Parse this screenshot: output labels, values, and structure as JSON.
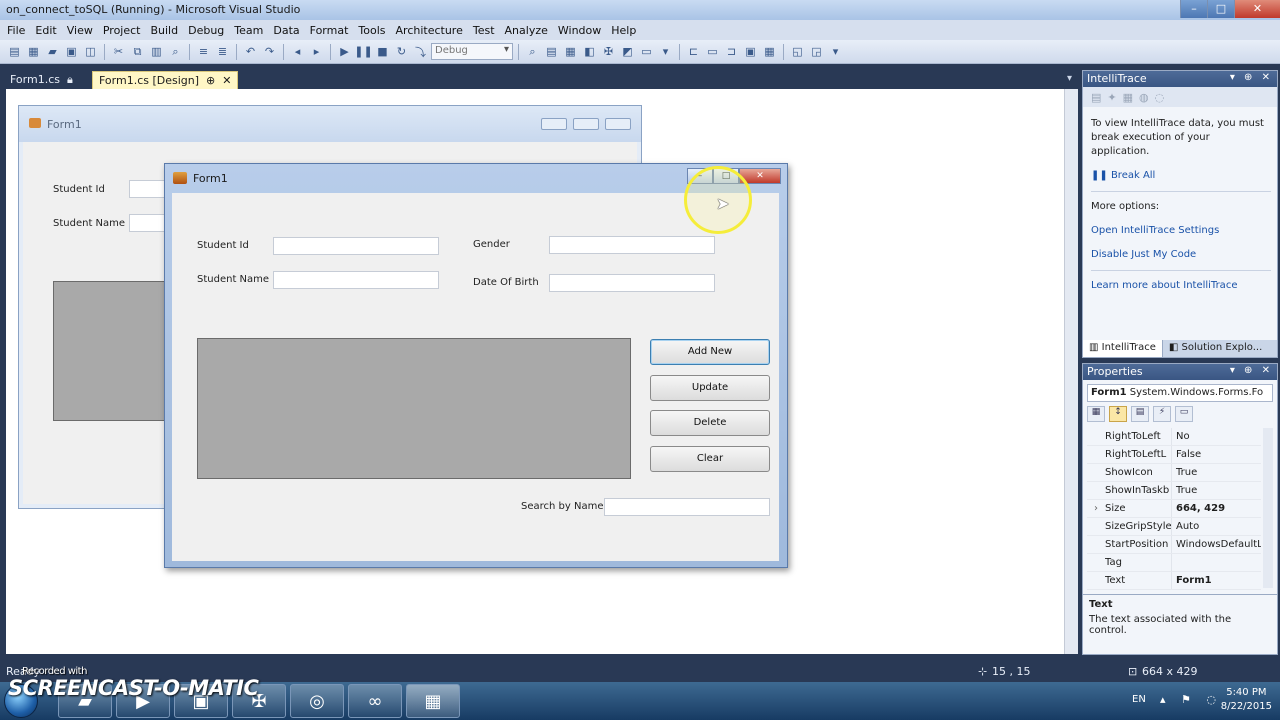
{
  "window": {
    "title": "on_connect_toSQL (Running) - Microsoft Visual Studio"
  },
  "menu": [
    "File",
    "Edit",
    "View",
    "Project",
    "Build",
    "Debug",
    "Team",
    "Data",
    "Format",
    "Tools",
    "Architecture",
    "Test",
    "Analyze",
    "Window",
    "Help"
  ],
  "toolbar": {
    "config": "Debug"
  },
  "tabs": [
    {
      "label": "Form1.cs"
    },
    {
      "label": "Form1.cs [Design]"
    }
  ],
  "designer_form": {
    "title": "Form1",
    "student_id_label": "Student Id",
    "student_name_label": "Student Name"
  },
  "running_form": {
    "title": "Form1",
    "student_id_label": "Student Id",
    "student_name_label": "Student Name",
    "gender_label": "Gender",
    "dob_label": "Date Of Birth",
    "add_new": "Add New",
    "update": "Update",
    "delete": "Delete",
    "clear": "Clear",
    "search_label": "Search by Name"
  },
  "intellitrace": {
    "title": "IntelliTrace",
    "message": "To view IntelliTrace data, you must break execution of your application.",
    "break_all": "Break All",
    "more_options": "More options:",
    "open_settings": "Open IntelliTrace Settings",
    "disable_jmc": "Disable Just My Code",
    "learn_more": "Learn more about IntelliTrace",
    "tab_intellitrace": "IntelliTrace",
    "tab_solution": "Solution Explo..."
  },
  "properties": {
    "title": "Properties",
    "object": "Form1",
    "object_type": "System.Windows.Forms.Fo",
    "rows": [
      {
        "name": "RightToLeft",
        "value": "No",
        "bold": false,
        "expand": ""
      },
      {
        "name": "RightToLeftL",
        "value": "False",
        "bold": false,
        "expand": ""
      },
      {
        "name": "ShowIcon",
        "value": "True",
        "bold": false,
        "expand": ""
      },
      {
        "name": "ShowInTaskb",
        "value": "True",
        "bold": false,
        "expand": ""
      },
      {
        "name": "Size",
        "value": "664, 429",
        "bold": true,
        "expand": "›"
      },
      {
        "name": "SizeGripStyle",
        "value": "Auto",
        "bold": false,
        "expand": ""
      },
      {
        "name": "StartPosition",
        "value": "WindowsDefaultL",
        "bold": false,
        "expand": ""
      },
      {
        "name": "Tag",
        "value": "",
        "bold": false,
        "expand": ""
      },
      {
        "name": "Text",
        "value": "Form1",
        "bold": true,
        "expand": ""
      }
    ],
    "desc_title": "Text",
    "desc_text": "The text associated with the control."
  },
  "status": {
    "left": "Ready",
    "position": "15 , 15",
    "size": "664 x 429"
  },
  "watermark": {
    "recorded": "Recorded with",
    "brand": "SCREENCAST-O-MATIC"
  },
  "tray": {
    "lang": "EN",
    "time": "5:40 PM",
    "date": "8/22/2015"
  },
  "colors": {
    "ide_frame": "#293955",
    "active_tab": "#fff7c6",
    "grid_gray": "#a9a9a9",
    "highlight_ring": "#f5ed3a"
  }
}
